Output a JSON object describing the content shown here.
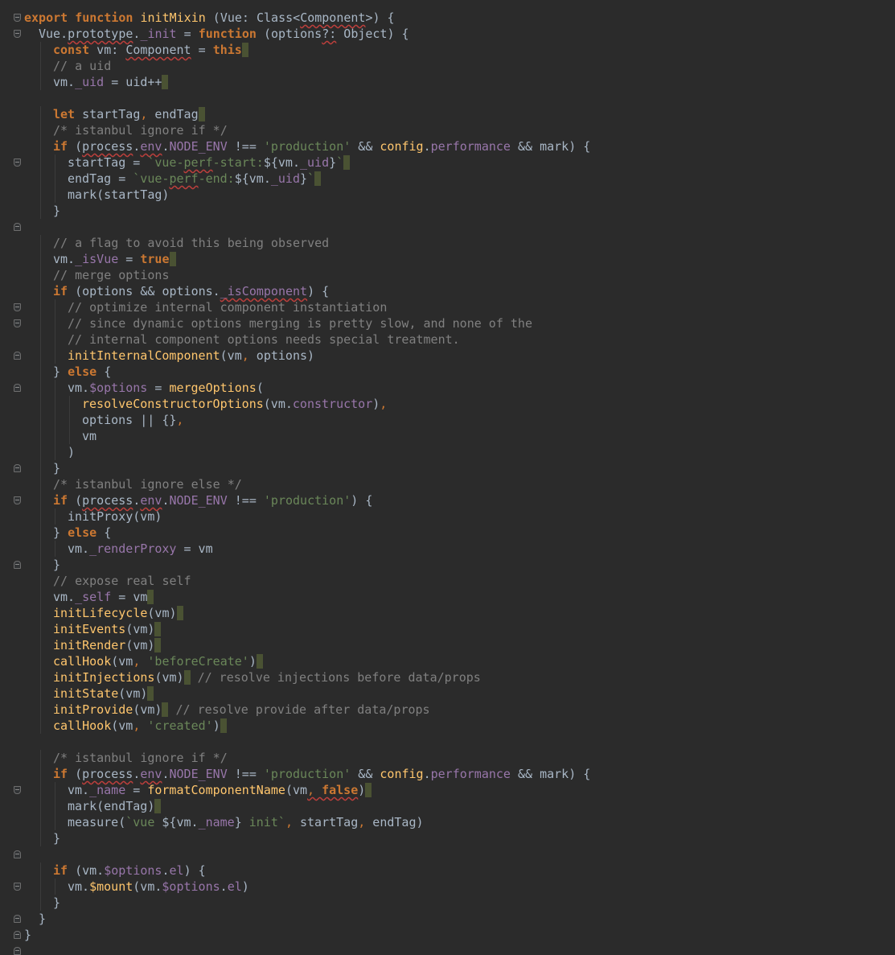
{
  "editor": {
    "fold_markers": [
      {
        "line": 1,
        "kind": "open"
      },
      {
        "line": 2,
        "kind": "open"
      },
      {
        "line": 10,
        "kind": "open"
      },
      {
        "line": 14,
        "kind": "close"
      },
      {
        "line": 19,
        "kind": "open"
      },
      {
        "line": 20,
        "kind": "open"
      },
      {
        "line": 22,
        "kind": "close"
      },
      {
        "line": 24,
        "kind": "close"
      },
      {
        "line": 29,
        "kind": "close"
      },
      {
        "line": 31,
        "kind": "open"
      },
      {
        "line": 35,
        "kind": "close"
      },
      {
        "line": 49,
        "kind": "open"
      },
      {
        "line": 53,
        "kind": "close"
      },
      {
        "line": 55,
        "kind": "open"
      },
      {
        "line": 57,
        "kind": "close"
      },
      {
        "line": 58,
        "kind": "close"
      },
      {
        "line": 59,
        "kind": "close"
      }
    ],
    "lines": [
      {
        "indent": 0,
        "tokens": [
          [
            "kw",
            "export"
          ],
          [
            "plain",
            " "
          ],
          [
            "kw",
            "function"
          ],
          [
            "plain",
            " "
          ],
          [
            "fn",
            "initMixin"
          ],
          [
            "plain",
            " (Vue: Class<"
          ],
          [
            "plain",
            "Component",
            "warn"
          ],
          [
            "plain",
            ">) {"
          ]
        ]
      },
      {
        "indent": 1,
        "tokens": [
          [
            "plain",
            "Vue."
          ],
          [
            "plain",
            "prototype",
            "warn"
          ],
          [
            "plain",
            "."
          ],
          [
            "prop",
            "_init"
          ],
          [
            "plain",
            " = "
          ],
          [
            "kw",
            "function"
          ],
          [
            "plain",
            " (options"
          ],
          [
            "plain",
            "?:",
            "warn"
          ],
          [
            "plain",
            " Object) {"
          ]
        ]
      },
      {
        "indent": 2,
        "caret": true,
        "tokens": [
          [
            "kw",
            "const"
          ],
          [
            "plain",
            " vm: "
          ],
          [
            "plain",
            "Component",
            "warn"
          ],
          [
            "plain",
            " = "
          ],
          [
            "kw",
            "this"
          ]
        ]
      },
      {
        "indent": 2,
        "tokens": [
          [
            "cmt",
            "// a uid"
          ]
        ]
      },
      {
        "indent": 2,
        "caret": true,
        "tokens": [
          [
            "plain",
            "vm."
          ],
          [
            "prop",
            "_uid"
          ],
          [
            "plain",
            " = uid++"
          ]
        ]
      },
      {
        "indent": 0,
        "tokens": []
      },
      {
        "indent": 2,
        "caret": true,
        "tokens": [
          [
            "kw",
            "let"
          ],
          [
            "plain",
            " startTag"
          ],
          [
            "punc",
            ","
          ],
          [
            "plain",
            " endTag"
          ]
        ]
      },
      {
        "indent": 2,
        "tokens": [
          [
            "cmt",
            "/* istanbul ignore if */"
          ]
        ]
      },
      {
        "indent": 2,
        "tokens": [
          [
            "kw",
            "if"
          ],
          [
            "plain",
            " ("
          ],
          [
            "plain",
            "process",
            "warn"
          ],
          [
            "plain",
            "."
          ],
          [
            "prop",
            "env",
            "warn"
          ],
          [
            "plain",
            "."
          ],
          [
            "prop",
            "NODE_ENV"
          ],
          [
            "plain",
            " !== "
          ],
          [
            "str",
            "'production'"
          ],
          [
            "plain",
            " && "
          ],
          [
            "fn",
            "config"
          ],
          [
            "plain",
            "."
          ],
          [
            "prop",
            "performance"
          ],
          [
            "plain",
            " && mark) {"
          ]
        ]
      },
      {
        "indent": 3,
        "caret": true,
        "tokens": [
          [
            "plain",
            "startTag = "
          ],
          [
            "str",
            "`vue-"
          ],
          [
            "str",
            "perf",
            "warn"
          ],
          [
            "str",
            "-start:"
          ],
          [
            "plain",
            "${vm."
          ],
          [
            "prop",
            "_uid"
          ],
          [
            "plain",
            "}"
          ],
          [
            "str",
            "`"
          ]
        ]
      },
      {
        "indent": 3,
        "caret": true,
        "tokens": [
          [
            "plain",
            "endTag = "
          ],
          [
            "str",
            "`vue-"
          ],
          [
            "str",
            "perf",
            "warn"
          ],
          [
            "str",
            "-end:"
          ],
          [
            "plain",
            "${vm."
          ],
          [
            "prop",
            "_uid"
          ],
          [
            "plain",
            "}"
          ],
          [
            "str",
            "`"
          ]
        ]
      },
      {
        "indent": 3,
        "tokens": [
          [
            "plain",
            "mark(startTag)"
          ]
        ]
      },
      {
        "indent": 2,
        "tokens": [
          [
            "plain",
            "}"
          ]
        ]
      },
      {
        "indent": 0,
        "tokens": []
      },
      {
        "indent": 2,
        "tokens": [
          [
            "cmt",
            "// a flag to avoid this being observed"
          ]
        ]
      },
      {
        "indent": 2,
        "caret": true,
        "tokens": [
          [
            "plain",
            "vm."
          ],
          [
            "prop",
            "_isVue"
          ],
          [
            "plain",
            " = "
          ],
          [
            "kw",
            "true"
          ]
        ]
      },
      {
        "indent": 2,
        "tokens": [
          [
            "cmt",
            "// merge options"
          ]
        ]
      },
      {
        "indent": 2,
        "tokens": [
          [
            "kw",
            "if"
          ],
          [
            "plain",
            " (options && options."
          ],
          [
            "prop",
            "_isComponent",
            "warn"
          ],
          [
            "plain",
            ") {"
          ]
        ]
      },
      {
        "indent": 3,
        "tokens": [
          [
            "cmt",
            "// optimize internal component instantiation"
          ]
        ]
      },
      {
        "indent": 3,
        "tokens": [
          [
            "cmt",
            "// since dynamic options merging is pretty slow, and none of the"
          ]
        ]
      },
      {
        "indent": 3,
        "tokens": [
          [
            "cmt",
            "// internal component options needs special treatment."
          ]
        ]
      },
      {
        "indent": 3,
        "tokens": [
          [
            "fn",
            "initInternalComponent"
          ],
          [
            "plain",
            "(vm"
          ],
          [
            "punc",
            ","
          ],
          [
            "plain",
            " options)"
          ]
        ]
      },
      {
        "indent": 2,
        "tokens": [
          [
            "plain",
            "} "
          ],
          [
            "kw",
            "else"
          ],
          [
            "plain",
            " {"
          ]
        ]
      },
      {
        "indent": 3,
        "tokens": [
          [
            "plain",
            "vm."
          ],
          [
            "prop",
            "$options"
          ],
          [
            "plain",
            " = "
          ],
          [
            "fn",
            "mergeOptions"
          ],
          [
            "plain",
            "("
          ]
        ]
      },
      {
        "indent": 4,
        "tokens": [
          [
            "fn",
            "resolveConstructorOptions"
          ],
          [
            "plain",
            "(vm."
          ],
          [
            "prop",
            "constructor"
          ],
          [
            "plain",
            ")"
          ],
          [
            "punc",
            ","
          ]
        ]
      },
      {
        "indent": 4,
        "tokens": [
          [
            "plain",
            "options || {}"
          ],
          [
            "punc",
            ","
          ]
        ]
      },
      {
        "indent": 4,
        "tokens": [
          [
            "plain",
            "vm"
          ]
        ]
      },
      {
        "indent": 3,
        "tokens": [
          [
            "plain",
            ")"
          ]
        ]
      },
      {
        "indent": 2,
        "tokens": [
          [
            "plain",
            "}"
          ]
        ]
      },
      {
        "indent": 2,
        "tokens": [
          [
            "cmt",
            "/* istanbul ignore else */"
          ]
        ]
      },
      {
        "indent": 2,
        "tokens": [
          [
            "kw",
            "if"
          ],
          [
            "plain",
            " ("
          ],
          [
            "plain",
            "process",
            "warn"
          ],
          [
            "plain",
            "."
          ],
          [
            "prop",
            "env",
            "warn"
          ],
          [
            "plain",
            "."
          ],
          [
            "prop",
            "NODE_ENV"
          ],
          [
            "plain",
            " !== "
          ],
          [
            "str",
            "'production'"
          ],
          [
            "plain",
            ") {"
          ]
        ]
      },
      {
        "indent": 3,
        "tokens": [
          [
            "plain",
            "initProxy(vm)"
          ]
        ]
      },
      {
        "indent": 2,
        "tokens": [
          [
            "plain",
            "} "
          ],
          [
            "kw",
            "else"
          ],
          [
            "plain",
            " {"
          ]
        ]
      },
      {
        "indent": 3,
        "tokens": [
          [
            "plain",
            "vm."
          ],
          [
            "prop",
            "_renderProxy"
          ],
          [
            "plain",
            " = vm"
          ]
        ]
      },
      {
        "indent": 2,
        "tokens": [
          [
            "plain",
            "}"
          ]
        ]
      },
      {
        "indent": 2,
        "tokens": [
          [
            "cmt",
            "// expose real self"
          ]
        ]
      },
      {
        "indent": 2,
        "caret": true,
        "tokens": [
          [
            "plain",
            "vm."
          ],
          [
            "prop",
            "_self"
          ],
          [
            "plain",
            " = vm"
          ]
        ]
      },
      {
        "indent": 2,
        "caret": true,
        "tokens": [
          [
            "fn",
            "initLifecycle"
          ],
          [
            "plain",
            "(vm)"
          ]
        ]
      },
      {
        "indent": 2,
        "caret": true,
        "tokens": [
          [
            "fn",
            "initEvents"
          ],
          [
            "plain",
            "(vm)"
          ]
        ]
      },
      {
        "indent": 2,
        "caret": true,
        "tokens": [
          [
            "fn",
            "initRender"
          ],
          [
            "plain",
            "(vm)"
          ]
        ]
      },
      {
        "indent": 2,
        "caret": true,
        "tokens": [
          [
            "fn",
            "callHook"
          ],
          [
            "plain",
            "(vm"
          ],
          [
            "punc",
            ","
          ],
          [
            "plain",
            " "
          ],
          [
            "str",
            "'beforeCreate'"
          ],
          [
            "plain",
            ")"
          ]
        ]
      },
      {
        "indent": 2,
        "caret_mid": true,
        "tokens": [
          [
            "fn",
            "initInjections"
          ],
          [
            "plain",
            "(vm)"
          ],
          [
            "caret",
            ""
          ],
          [
            "cmt",
            " // resolve injections before data/props"
          ]
        ]
      },
      {
        "indent": 2,
        "caret": true,
        "tokens": [
          [
            "fn",
            "initState"
          ],
          [
            "plain",
            "(vm)"
          ]
        ]
      },
      {
        "indent": 2,
        "caret_mid": true,
        "tokens": [
          [
            "fn",
            "initProvide"
          ],
          [
            "plain",
            "(vm)"
          ],
          [
            "caret",
            ""
          ],
          [
            "cmt",
            " // resolve provide after data/props"
          ]
        ]
      },
      {
        "indent": 2,
        "caret": true,
        "tokens": [
          [
            "fn",
            "callHook"
          ],
          [
            "plain",
            "(vm"
          ],
          [
            "punc",
            ","
          ],
          [
            "plain",
            " "
          ],
          [
            "str",
            "'created'"
          ],
          [
            "plain",
            ")"
          ]
        ]
      },
      {
        "indent": 0,
        "tokens": []
      },
      {
        "indent": 2,
        "tokens": [
          [
            "cmt",
            "/* istanbul ignore if */"
          ]
        ]
      },
      {
        "indent": 2,
        "tokens": [
          [
            "kw",
            "if"
          ],
          [
            "plain",
            " ("
          ],
          [
            "plain",
            "process",
            "warn"
          ],
          [
            "plain",
            "."
          ],
          [
            "prop",
            "env",
            "warn"
          ],
          [
            "plain",
            "."
          ],
          [
            "prop",
            "NODE_ENV"
          ],
          [
            "plain",
            " !== "
          ],
          [
            "str",
            "'production'"
          ],
          [
            "plain",
            " && "
          ],
          [
            "fn",
            "config"
          ],
          [
            "plain",
            "."
          ],
          [
            "prop",
            "performance"
          ],
          [
            "plain",
            " && mark) {"
          ]
        ]
      },
      {
        "indent": 3,
        "caret": true,
        "tokens": [
          [
            "plain",
            "vm."
          ],
          [
            "prop",
            "_name"
          ],
          [
            "plain",
            " = "
          ],
          [
            "fn",
            "formatComponentName"
          ],
          [
            "plain",
            "(vm"
          ],
          [
            "punc",
            ",",
            "warn"
          ],
          [
            "kw",
            " false",
            "warn"
          ],
          [
            "plain",
            ")"
          ]
        ]
      },
      {
        "indent": 3,
        "caret": true,
        "tokens": [
          [
            "plain",
            "mark(endTag)"
          ]
        ]
      },
      {
        "indent": 3,
        "tokens": [
          [
            "plain",
            "measure("
          ],
          [
            "str",
            "`vue "
          ],
          [
            "plain",
            "${vm."
          ],
          [
            "prop",
            "_name"
          ],
          [
            "plain",
            "}"
          ],
          [
            "str",
            " init`"
          ],
          [
            "punc",
            ","
          ],
          [
            "plain",
            " startTag"
          ],
          [
            "punc",
            ","
          ],
          [
            "plain",
            " endTag)"
          ]
        ]
      },
      {
        "indent": 2,
        "tokens": [
          [
            "plain",
            "}"
          ]
        ]
      },
      {
        "indent": 0,
        "tokens": []
      },
      {
        "indent": 2,
        "tokens": [
          [
            "kw",
            "if"
          ],
          [
            "plain",
            " (vm."
          ],
          [
            "prop",
            "$options"
          ],
          [
            "plain",
            "."
          ],
          [
            "prop",
            "el"
          ],
          [
            "plain",
            ") {"
          ]
        ]
      },
      {
        "indent": 3,
        "tokens": [
          [
            "plain",
            "vm."
          ],
          [
            "fn",
            "$mount"
          ],
          [
            "plain",
            "(vm."
          ],
          [
            "prop",
            "$options"
          ],
          [
            "plain",
            "."
          ],
          [
            "prop",
            "el"
          ],
          [
            "plain",
            ")"
          ]
        ]
      },
      {
        "indent": 2,
        "tokens": [
          [
            "plain",
            "}"
          ]
        ]
      },
      {
        "indent": 1,
        "tokens": [
          [
            "plain",
            "}"
          ]
        ]
      },
      {
        "indent": 0,
        "tokens": [
          [
            "plain",
            "}"
          ]
        ]
      }
    ]
  }
}
